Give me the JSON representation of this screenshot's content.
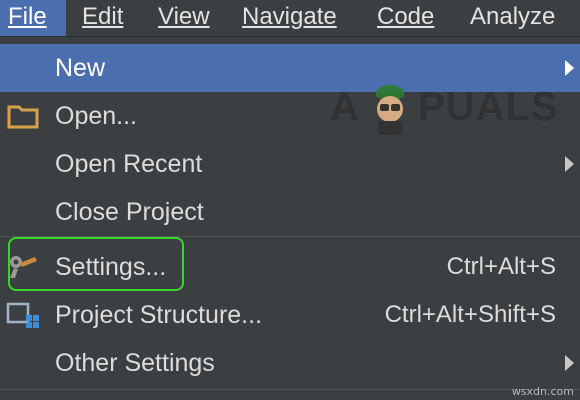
{
  "menubar": {
    "items": [
      {
        "label": "File",
        "active": true
      },
      {
        "label": "Edit"
      },
      {
        "label": "View"
      },
      {
        "label": "Navigate"
      },
      {
        "label": "Code"
      },
      {
        "label": "Analyze"
      }
    ]
  },
  "file_menu": {
    "items": [
      {
        "label": "New",
        "submenu": true,
        "selected": true
      },
      {
        "label": "Open...",
        "icon": "folder-icon"
      },
      {
        "label": "Open Recent",
        "submenu": true
      },
      {
        "label": "Close Project"
      },
      {
        "label": "Settings...",
        "shortcut": "Ctrl+Alt+S",
        "icon": "wrench-icon",
        "highlighted": true
      },
      {
        "label": "Project Structure...",
        "shortcut": "Ctrl+Alt+Shift+S",
        "icon": "project-structure-icon"
      },
      {
        "label": "Other Settings",
        "submenu": true
      }
    ]
  },
  "watermark": {
    "text_a": "A",
    "text_rest": "PUALS",
    "logo": "appuals-mascot"
  },
  "corner_text": "wsxdn.com",
  "colors": {
    "menu_bg": "#3c3f41",
    "selection": "#4b6eaf",
    "highlight_box": "#36d62d",
    "text": "#dcdcdc"
  }
}
